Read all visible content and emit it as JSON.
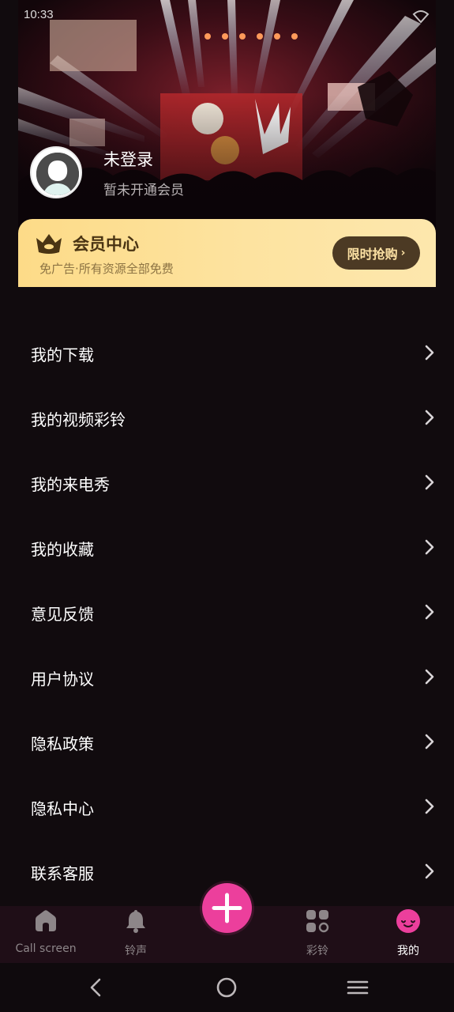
{
  "status_bar": {
    "time": "10:33"
  },
  "profile": {
    "name": "未登录",
    "subtitle": "暂未开通会员"
  },
  "vip": {
    "title": "会员中心",
    "subtitle": "免广告·所有资源全部免费",
    "button_label": "限时抢购",
    "button_chevron": "›",
    "colors": {
      "card": "#fddb88",
      "button": "#4c3a24",
      "button_text": "#fde2a4"
    }
  },
  "menu": {
    "items": [
      {
        "label": "我的下载"
      },
      {
        "label": "我的视频彩铃"
      },
      {
        "label": "我的来电秀"
      },
      {
        "label": "我的收藏"
      },
      {
        "label": "意见反馈"
      },
      {
        "label": "用户协议"
      },
      {
        "label": "隐私政策"
      },
      {
        "label": "隐私中心"
      },
      {
        "label": "联系客服"
      }
    ]
  },
  "bottom_nav": {
    "items": [
      {
        "label": "Call screen",
        "icon": "home-icon",
        "active": false
      },
      {
        "label": "铃声",
        "icon": "bell-icon",
        "active": false
      },
      {
        "label": "彩铃",
        "icon": "grid-icon",
        "active": false
      },
      {
        "label": "我的",
        "icon": "smiley-icon",
        "active": true
      }
    ],
    "fab_icon": "plus-icon",
    "accent": "#ec3f9c"
  }
}
